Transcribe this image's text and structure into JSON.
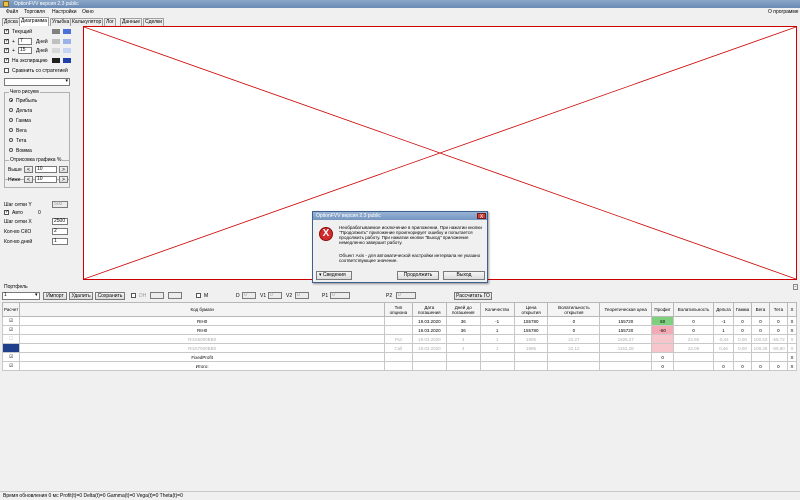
{
  "window": {
    "title": "OptionFVV версия 2.3 public"
  },
  "menu": {
    "items": [
      "Файл",
      "Торговля",
      "Настройки",
      "Окно"
    ],
    "about": "О программе"
  },
  "tabs": [
    "Доска",
    "Диаграмма",
    "Улыбка",
    "Калькулятор",
    "Лог",
    "Данные",
    "Сделки"
  ],
  "left": {
    "current": "Текущий",
    "plus_value": "7",
    "plus_unit": "Дней",
    "plus2_value": "15",
    "plus2_unit": "Дней",
    "expiry": "На экспирацию",
    "compare": "Сравнить со стратегией",
    "draw_group": "Чего рисуем",
    "draw_options": [
      "Прибыль",
      "Дельта",
      "Гамма",
      "Вега",
      "Тета",
      "Вомма"
    ],
    "draw_selected": "Прибыль",
    "render_group": "Отрисовка графика %",
    "above_label": "Выше",
    "above_value": "10",
    "below_label": "Ниже",
    "below_value": "10",
    "grid_y_label": "Шаг сетки Y",
    "grid_y_value": "500",
    "auto_label": "Авто",
    "auto_value": "0",
    "grid_x_label": "Шаг сетки X",
    "grid_x_value": "2500",
    "sko_label": "Кол-во СКО",
    "sko_value": "2",
    "days_label": "Кол-во дней",
    "days_value": "1",
    "minus_btn": "<",
    "plus_btn": ">",
    "plus_sign": "+"
  },
  "portfolio": {
    "title": "Портфель",
    "select_value": "1",
    "import_btn": "Импорт",
    "delete_btn": "Удалить",
    "save_btn": "Сохранить",
    "dh_label": "DH",
    "m_label": "M",
    "d_label": "D",
    "d_value": "0",
    "v1_label": "V1",
    "v1_value": "0",
    "v2_label": "V2",
    "v2_value": "0",
    "p1_label": "P1",
    "p1_value": "0",
    "p2_label": "P2",
    "p2_value": "0",
    "calc_go_btn": "Рассчитать ГО"
  },
  "table": {
    "headers": [
      "Расчет",
      "Код бумаги",
      "Тип опциона",
      "Дата погашения",
      "Дней до погашения",
      "Количество",
      "Цена открытия",
      "Волатильность открытия",
      "Теоретическая цена",
      "Профит",
      "Волатильность",
      "Дельта",
      "Гамма",
      "Вега",
      "Тета",
      "X"
    ],
    "rows": [
      {
        "check": "☑",
        "cells": [
          "RIH0",
          "",
          "19.03.2020",
          "36",
          "-1",
          "155780",
          "0",
          "155720",
          "60",
          "0",
          "-1",
          "0",
          "0",
          "0",
          "X"
        ],
        "style": "normal",
        "profit": "green"
      },
      {
        "check": "☑",
        "cells": [
          "RIH0",
          "",
          "19.03.2020",
          "36",
          "1",
          "155780",
          "0",
          "155720",
          "-60",
          "0",
          "1",
          "0",
          "0",
          "0",
          "X"
        ],
        "style": "normal",
        "profit": "pink"
      },
      {
        "check": "☐",
        "cells": [
          "RI155000BB0",
          "Put",
          "19.03.2020",
          "4",
          "1",
          "1905",
          "22,27",
          "1826,27",
          "",
          "22,66",
          "-0,44",
          "0,00",
          "100,53",
          "-59,72",
          "X"
        ],
        "style": "gray",
        "profit": "pinklite"
      },
      {
        "check": "■",
        "cells": [
          "RI157500BB0",
          "Call",
          "19.03.2020",
          "4",
          "1",
          "1895",
          "22,12",
          "1152,28",
          "",
          "22,09",
          "0,46",
          "0,00",
          "109,26",
          "-59,80",
          "X"
        ],
        "style": "gray",
        "profit": "pinklite"
      },
      {
        "check": "☑",
        "cells": [
          "FixedProfit",
          "",
          "",
          "",
          "",
          "",
          "",
          "",
          "0",
          "",
          "",
          "",
          "",
          "",
          "X"
        ],
        "style": "normal",
        "profit": ""
      },
      {
        "check": "☑",
        "cells": [
          "Итого:",
          "",
          "",
          "",
          "",
          "",
          "",
          "",
          "0",
          "",
          "0",
          "0",
          "0",
          "0",
          "X"
        ],
        "style": "normal",
        "profit": ""
      }
    ]
  },
  "dialog": {
    "title": "OptionFVV версия 2.3 public",
    "close": "X",
    "icon_glyph": "X",
    "message1": "Необрабатываемое исключение в приложении. При нажатии кнопки \"Продолжить\" приложение проигнорирует ошибку и попытается продолжить работу. При нажатии кнопки \"Выход\" приложение немедленно завершит работу.",
    "message2": "Объект Axis - для автоматической настройки интервала не указано соответствующее значение.",
    "details_btn": "Сведения",
    "continue_btn": "Продолжить",
    "exit_btn": "Выход"
  },
  "status": {
    "text": "Время обновления 0 мс  Profit(t)=0 Delta(t)=0 Gamma(t)=0 Vega(t)=0 Theta(t)=0"
  },
  "colors": {
    "chart_border": "#cc0000",
    "profit_pos": "#7ed07e",
    "profit_neg": "#f4a9b4",
    "swatch1": "#4a6fd6",
    "swatch2": "#9ab2e8",
    "swatch3": "#1f3fa8"
  }
}
